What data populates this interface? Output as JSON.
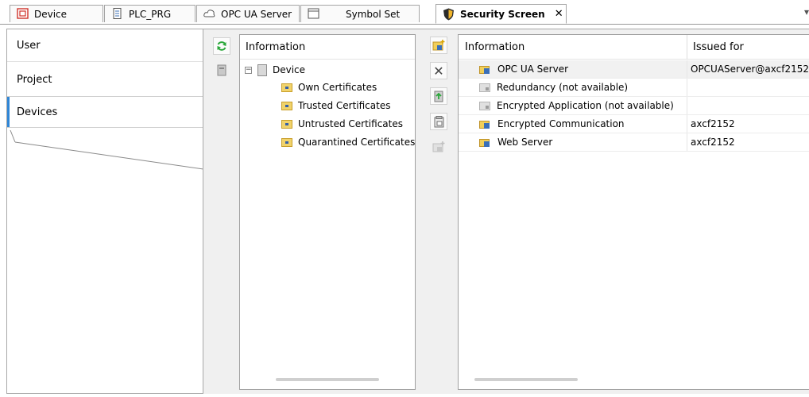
{
  "tabs": [
    {
      "label": "Device",
      "icon": "device-icon",
      "active": false
    },
    {
      "label": "PLC_PRG",
      "icon": "document-icon",
      "active": false
    },
    {
      "label": "OPC UA Server",
      "icon": "cloud-icon",
      "active": false
    },
    {
      "label": "Symbol Set",
      "icon": "window-icon",
      "active": false
    },
    {
      "label": "Security Screen",
      "icon": "shield-icon",
      "active": true,
      "close": "✕"
    }
  ],
  "tab_overflow": "▾",
  "categories": [
    {
      "label": "User",
      "selected": false
    },
    {
      "label": "Project",
      "selected": false
    },
    {
      "label": "Devices",
      "selected": true
    }
  ],
  "tree": {
    "header": "Information",
    "root": {
      "label": "Device",
      "expander": "−"
    },
    "children": [
      {
        "label": "Own Certificates"
      },
      {
        "label": "Trusted Certificates"
      },
      {
        "label": "Untrusted Certificates"
      },
      {
        "label": "Quarantined Certificates"
      }
    ]
  },
  "list": {
    "headers": {
      "information": "Information",
      "issued_for": "Issued for"
    },
    "rows": [
      {
        "information": "OPC UA Server",
        "issued_for": "OPCUAServer@axcf2152",
        "available": true
      },
      {
        "information": "Redundancy (not available)",
        "issued_for": "",
        "available": false
      },
      {
        "information": "Encrypted Application (not available)",
        "issued_for": "",
        "available": false
      },
      {
        "information": "Encrypted Communication",
        "issued_for": "axcf2152",
        "available": true
      },
      {
        "information": "Web Server",
        "issued_for": "axcf2152",
        "available": true
      }
    ]
  },
  "toolbar_left": {
    "refresh": "refresh-icon",
    "device_tool": "device-tool-icon"
  },
  "toolbar_mid": {
    "create": "create-certificate-icon",
    "remove": "✕",
    "install": "install-certificate-icon",
    "export": "export-certificate-icon",
    "renew": "renew-certificate-icon"
  },
  "colors": {
    "accent": "#2f86d6",
    "folder": "#f1d36b",
    "refresh": "#2aa73a"
  }
}
